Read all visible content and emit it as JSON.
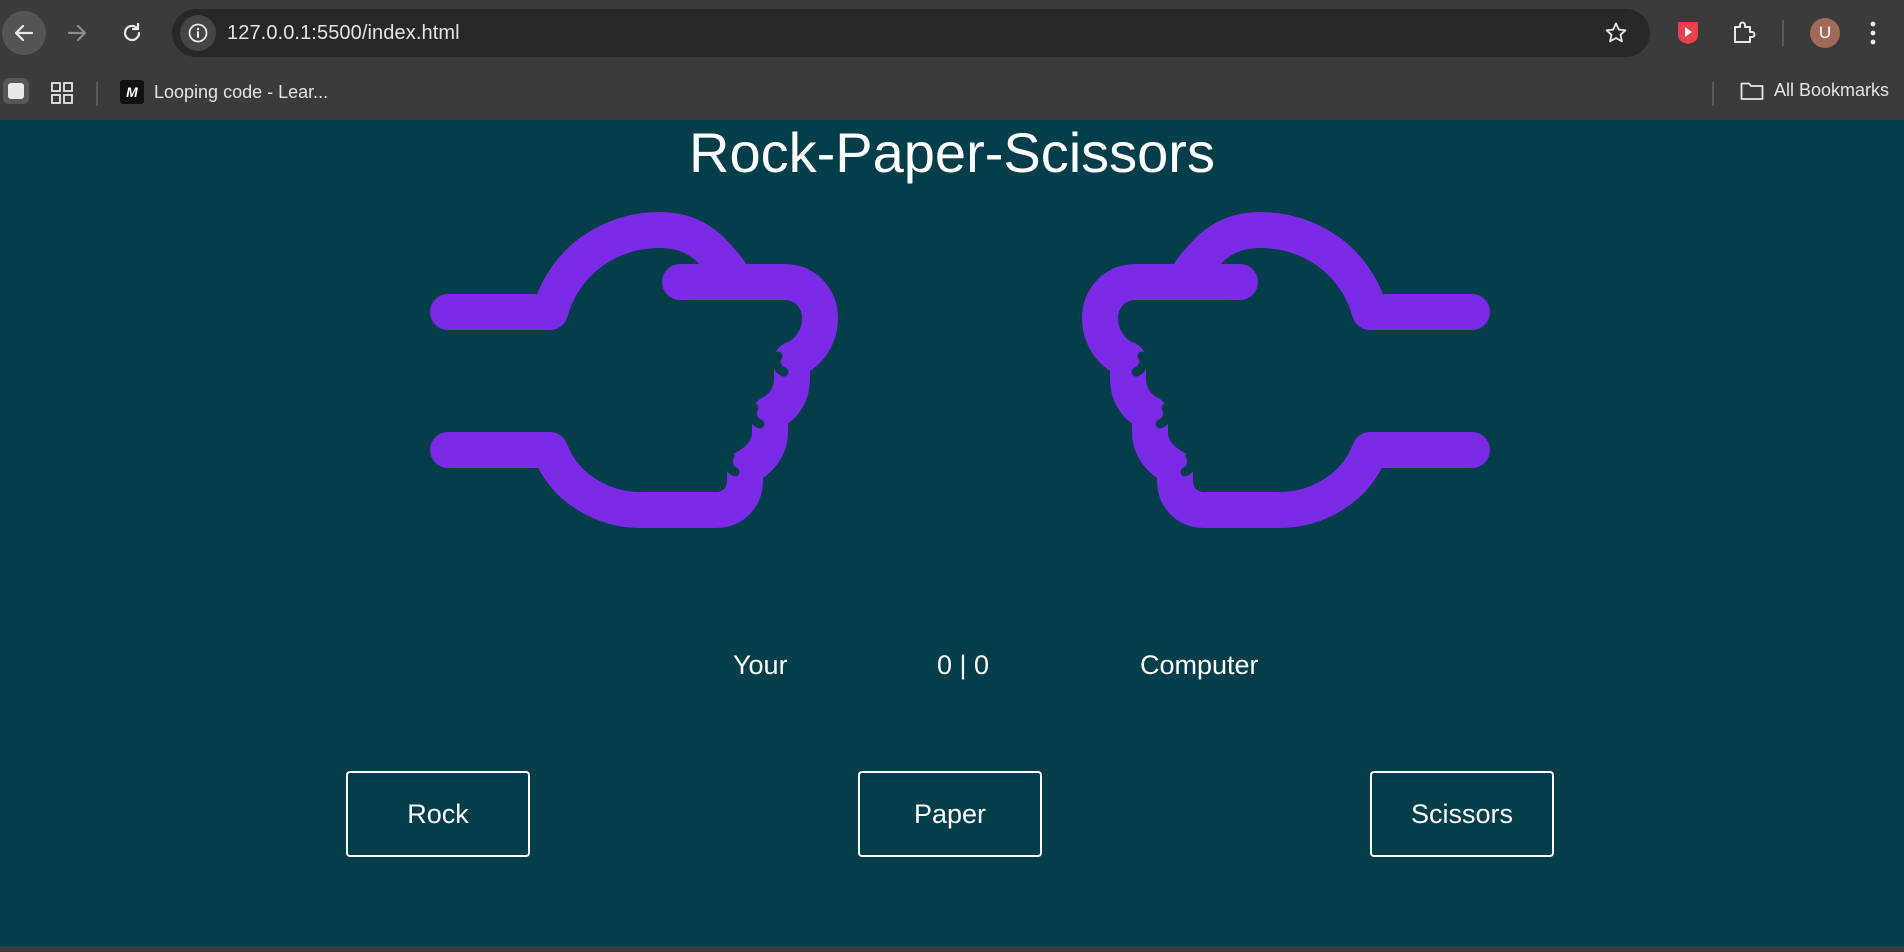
{
  "browser": {
    "url": "127.0.0.1:5500/index.html",
    "bookmarks": [
      {
        "label": "Looping code - Lear...",
        "favicon_text": "M"
      }
    ],
    "all_bookmarks_label": "All Bookmarks",
    "avatar_initial": "U"
  },
  "game": {
    "title": "Rock-Paper-Scissors",
    "player_label": "Your",
    "score": "0 | 0",
    "computer_label": "Computer",
    "buttons": {
      "rock": "Rock",
      "paper": "Paper",
      "scissors": "Scissors"
    },
    "colors": {
      "background": "#033e4a",
      "hand": "#7b2be6",
      "text": "#ffffff"
    },
    "player_hand": "rock",
    "computer_hand": "rock"
  }
}
